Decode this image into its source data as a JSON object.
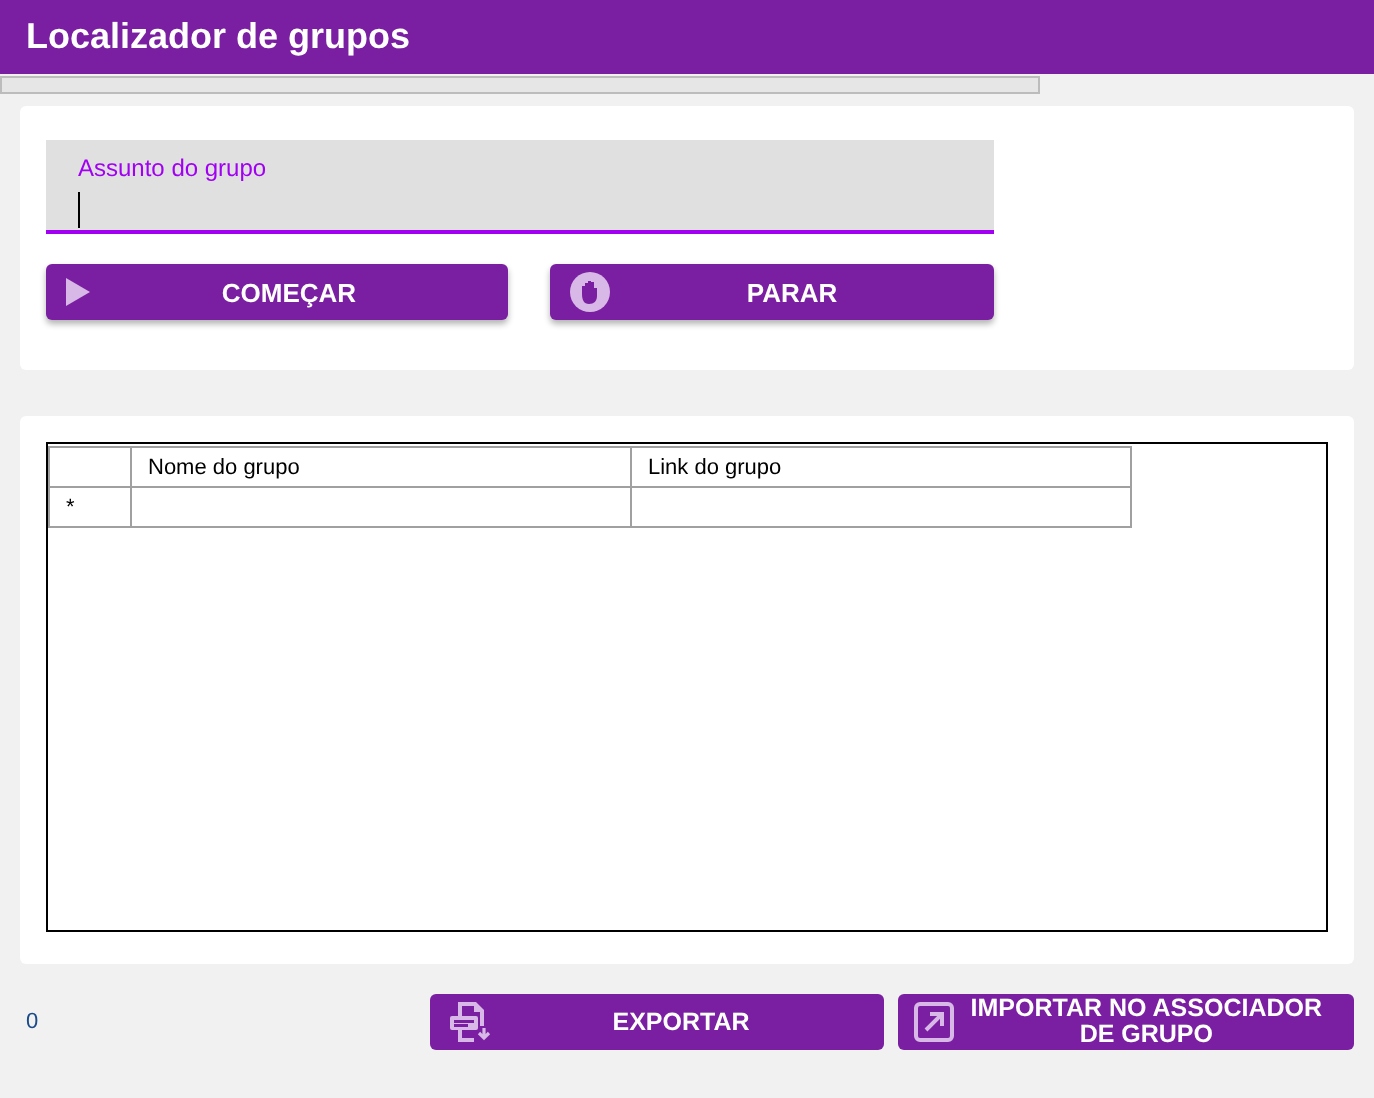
{
  "window": {
    "title": "Localizador de grupos"
  },
  "progress": {
    "level": 0
  },
  "search": {
    "label": "Assunto do grupo"
  },
  "actions": [
    {
      "label": "COMEÇAR",
      "kind": "play"
    },
    {
      "label": "PARAR",
      "kind": "stop"
    }
  ],
  "table": {
    "columns": [
      "Nome do grupo",
      "Link do grupo"
    ],
    "new_row_marker": "*"
  },
  "count": "0",
  "footer_buttons": [
    {
      "label": "EXPORTAR",
      "kind": "export"
    },
    {
      "label": "IMPORTAR NO ASSOCIADOR DE GRUPO",
      "kind": "import"
    }
  ]
}
